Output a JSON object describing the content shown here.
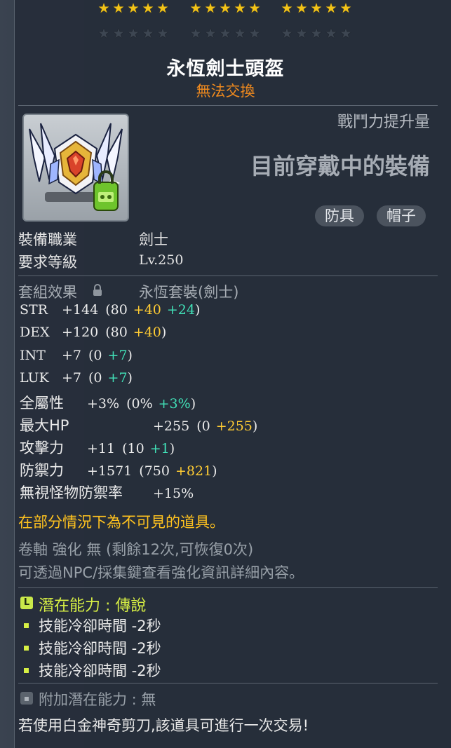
{
  "stars": {
    "rows": 2,
    "groups_per_row": 3,
    "stars_per_group": 5,
    "filled_rows": 1
  },
  "item": {
    "name": "永恆劍士頭盔",
    "trade": "無法交換",
    "icon": "helmet-icon"
  },
  "combat": {
    "label": "戰鬥力提升量",
    "value": "目前穿戴中的裝備"
  },
  "tags": [
    "防具",
    "帽子"
  ],
  "info": [
    {
      "key": "裝備職業",
      "value": "劍士"
    },
    {
      "key": "要求等級",
      "value": "Lv.250"
    }
  ],
  "set": {
    "key": "套組效果",
    "icon": "lock-icon",
    "value": "永恆套裝(劍士)"
  },
  "stats": [
    {
      "name": "STR",
      "total": "+144",
      "open": "(80",
      "bonus1": "+40",
      "bonus2": "+24",
      "close": ")"
    },
    {
      "name": "DEX",
      "total": "+120",
      "open": "(80",
      "bonus1": "+40",
      "bonus2": "",
      "close": ")"
    },
    {
      "name": "INT",
      "total": "+7",
      "open": "(0",
      "bonus1": "",
      "bonus2": "+7",
      "close": ")"
    },
    {
      "name": "LUK",
      "total": "+7",
      "open": "(0",
      "bonus1": "",
      "bonus2": "+7",
      "close": ")"
    },
    {
      "name": "全屬性",
      "total": "+3%",
      "open": "(0%",
      "bonus1": "",
      "bonus2": "+3%",
      "close": ")"
    },
    {
      "name": "最大HP",
      "total": "+255",
      "open": "(0",
      "bonus1": "+255",
      "bonus2": "",
      "close": ")"
    },
    {
      "name": "攻擊力",
      "total": "+11",
      "open": "(10",
      "bonus1": "",
      "bonus2": "+1",
      "close": ")"
    },
    {
      "name": "防禦力",
      "total": "+1571",
      "open": "(750",
      "bonus1": "+821",
      "bonus2": "",
      "close": ")"
    },
    {
      "name": "無視怪物防禦率",
      "total": "+15%",
      "open": "",
      "bonus1": "",
      "bonus2": "",
      "close": ""
    }
  ],
  "notice": "在部分情況下為不可見的道具。",
  "scroll": {
    "line1": "卷軸 強化 無 (剩餘12次,可恢復0次)",
    "line2": "可透過NPC/採集鍵查看強化資訊詳細內容。"
  },
  "potential": {
    "badge": "L",
    "title": "潛在能力 : 傳說",
    "lines": [
      "技能冷卻時間 -2秒",
      "技能冷卻時間 -2秒",
      "技能冷卻時間 -2秒"
    ]
  },
  "additional": {
    "title": "附加潛在能力 : 無"
  },
  "footer": "若使用白金神奇剪刀,該道具可進行一次交易!",
  "colors": {
    "star": "#f2c318",
    "trade": "#f08a1e",
    "bonus_yellow": "#ffcc33",
    "bonus_green": "#41e0b7",
    "potential": "#d7ef44"
  }
}
